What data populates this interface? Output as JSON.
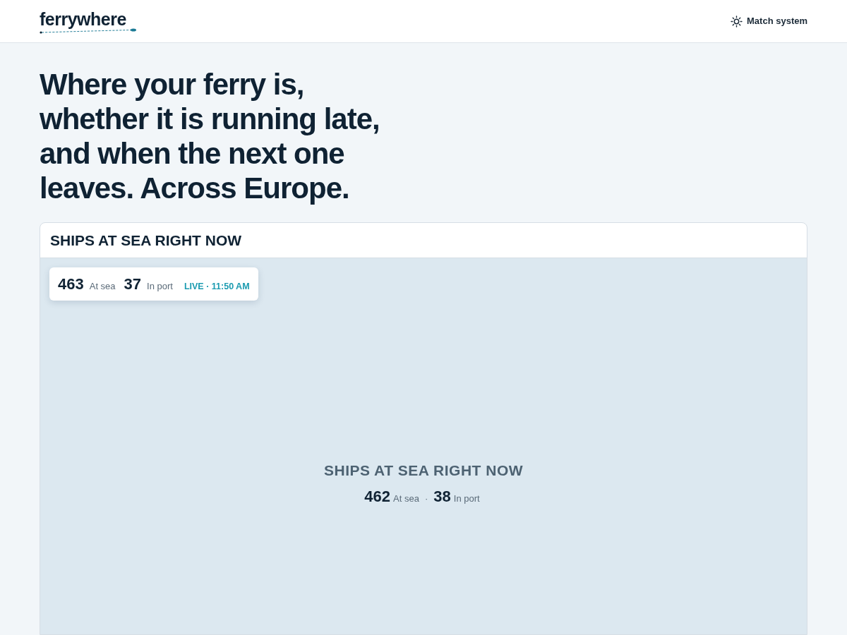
{
  "header": {
    "logo": "ferrywhere",
    "theme_button": "Match system"
  },
  "headline": "Where your ferry is, whether it is running late, and when the next one leaves. Across Europe.",
  "map_card": {
    "title": "SHIPS AT SEA RIGHT NOW",
    "live_stats": {
      "at_sea_count": "463",
      "at_sea_label": "At sea",
      "in_port_count": "37",
      "in_port_label": "In port",
      "live": "LIVE · 11:50 AM"
    },
    "placeholder": {
      "title": "SHIPS AT SEA RIGHT NOW",
      "at_sea_count": "462",
      "at_sea_label": "At sea",
      "separator": "·",
      "in_port_count": "38",
      "in_port_label": "In port"
    }
  }
}
